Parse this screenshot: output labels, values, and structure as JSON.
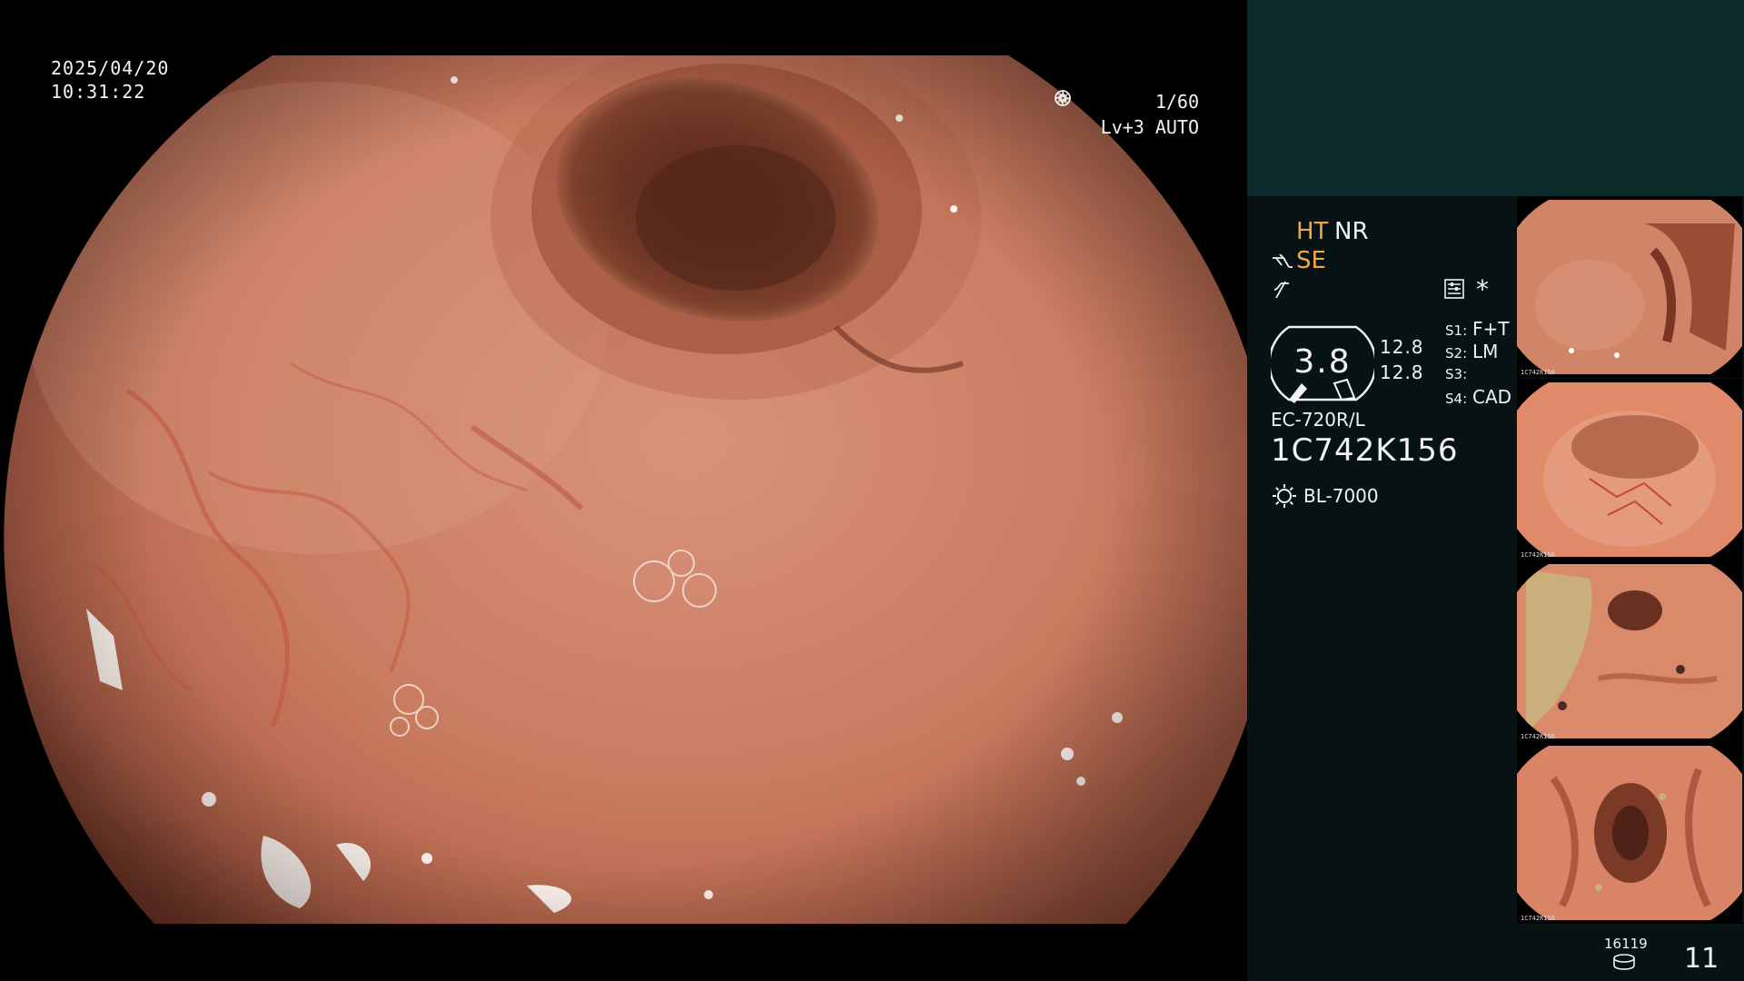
{
  "main": {
    "date": "2025/04/20",
    "time": "10:31:22",
    "shutter": "1/60",
    "shutter_icon": "shutter-icon",
    "level": "Lv+3",
    "mode": "AUTO",
    "mode_icon": "iris-icon"
  },
  "status": {
    "ht": "HT",
    "nr": "NR",
    "se": "SE",
    "asterisk": "*",
    "gauge_value": "3.8",
    "value_1": "12.8",
    "value_2": "12.8",
    "slots": [
      {
        "key": "S1:",
        "value": "F+T"
      },
      {
        "key": "S2:",
        "value": "LM"
      },
      {
        "key": "S3:",
        "value": ""
      },
      {
        "key": "S4:",
        "value": "CAD"
      }
    ],
    "scope_model": "EC-720R/L",
    "scope_serial": "1C742K156",
    "light_source": "BL-7000"
  },
  "footer": {
    "disk_count": "16119",
    "page_number": "11"
  },
  "thumbnails": [
    {
      "label": "1C742K156"
    },
    {
      "label": "1C742K156"
    },
    {
      "label": "1C742K156"
    },
    {
      "label": "1C742K156"
    }
  ],
  "colors": {
    "accent_orange": "#f4a640",
    "panel_bg": "#061214",
    "band_bg": "#0b2a2b",
    "mucosa": "#c9765a"
  }
}
